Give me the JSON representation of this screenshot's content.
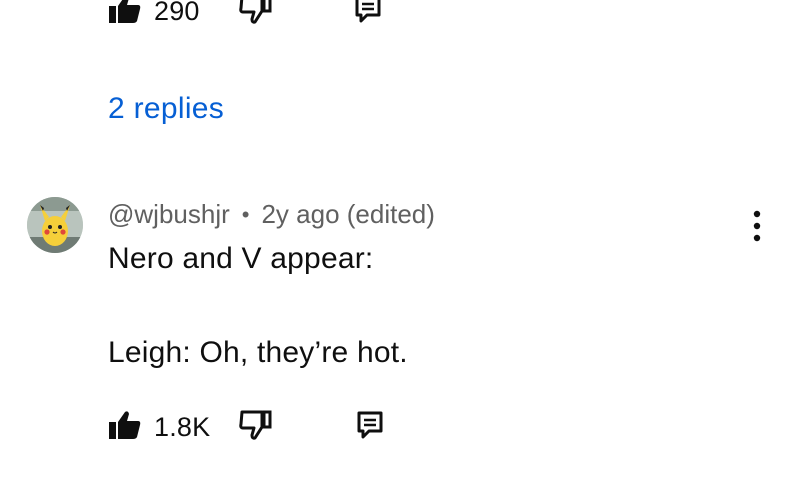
{
  "prev_comment": {
    "like_count": "290",
    "like_icon": "thumbs-up-filled-icon",
    "dislike_icon": "thumbs-down-outline-icon",
    "reply_icon": "reply-comment-icon"
  },
  "replies_link": "2 replies",
  "comment": {
    "avatar_icon": "pikachu-avatar",
    "author": "@wjbushjr",
    "separator": "•",
    "time": "2y ago (edited)",
    "line1": "Nero and V appear:",
    "line2": "Leigh: Oh, they’re hot.",
    "like_count": "1.8K",
    "like_icon": "thumbs-up-filled-icon",
    "dislike_icon": "thumbs-down-outline-icon",
    "reply_icon": "reply-comment-icon",
    "more_icon": "more-vertical-icon"
  },
  "colors": {
    "link": "#065fd4",
    "text": "#0f0f0f",
    "secondary": "#606060"
  }
}
